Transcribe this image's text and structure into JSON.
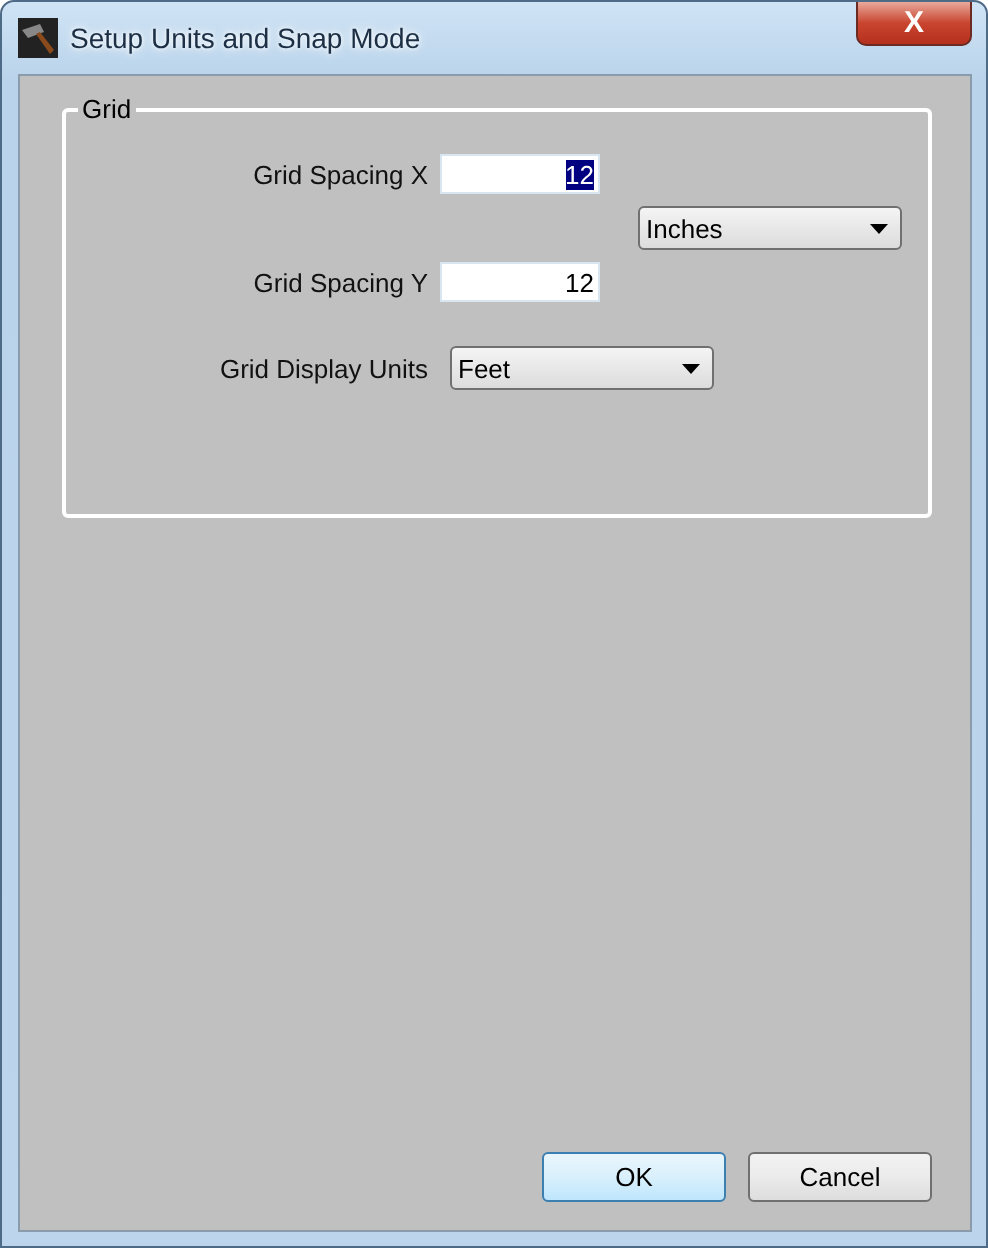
{
  "window": {
    "title": "Setup Units and Snap Mode",
    "close_label": "X"
  },
  "group": {
    "title": "Grid",
    "fields": [
      {
        "kind": "input",
        "label": "Grid Spacing X",
        "value": "12",
        "text_selected": true
      },
      {
        "kind": "dropdown",
        "value": "Inches"
      },
      {
        "kind": "input",
        "label": "Grid Spacing Y",
        "value": "12",
        "text_selected": false
      },
      {
        "kind": "dropdown",
        "label": "Grid Display Units",
        "value": "Feet"
      }
    ]
  },
  "buttons": [
    {
      "label": "OK",
      "default": true
    },
    {
      "label": "Cancel",
      "default": false
    }
  ]
}
